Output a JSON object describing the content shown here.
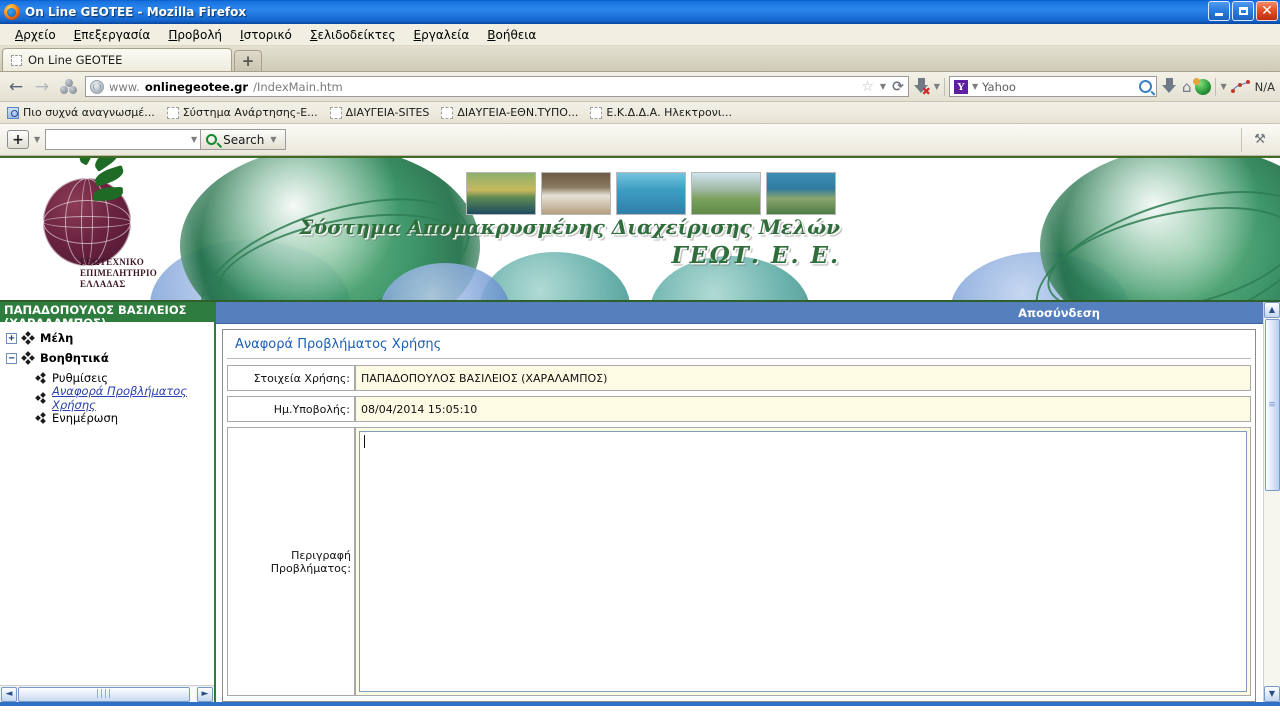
{
  "window": {
    "title": "On Line GEOTEE - Mozilla Firefox",
    "minimize_label": "Minimize",
    "maximize_label": "Maximize",
    "close_label": "✕"
  },
  "menu": {
    "items": [
      {
        "first": "Α",
        "rest": "ρχείο"
      },
      {
        "first": "Ε",
        "rest": "πεξεργασία"
      },
      {
        "first": "Π",
        "rest": "ροβολή"
      },
      {
        "first": "Ι",
        "rest": "στορικό"
      },
      {
        "first": "Σ",
        "rest": "ελιδοδείκτες"
      },
      {
        "first": "Ε",
        "rest": "ργαλεία"
      },
      {
        "first": "Β",
        "rest": "οήθεια"
      }
    ]
  },
  "tabs": {
    "active_tab_label": "On Line GEOTEE",
    "new_tab_label": "+"
  },
  "navbar": {
    "back_label": "←",
    "forward_label": "→",
    "url_prefix": "www.",
    "url_host": "onlinegeotee.gr",
    "url_path": "/IndexMain.htm",
    "star_label": "☆",
    "dropdown_label": "▼",
    "reload_label": "⟳",
    "search_engine": "Yahoo",
    "search_engine_badge": "Y",
    "search_placeholder": "Yahoo",
    "home_label": "⌂",
    "na_label": "N/A"
  },
  "bookmarks": {
    "items": [
      {
        "label": "Πιο συχνά αναγνωσμέ...",
        "icon": "folder-blue-icon"
      },
      {
        "label": "Σύστημα Ανάρτησης-Ε...",
        "icon": "blank-favicon"
      },
      {
        "label": "ΔΙΑΥΓΕΙΑ-SITES",
        "icon": "blank-favicon"
      },
      {
        "label": "ΔΙΑΥΓΕΙΑ-ΕΘΝ.ΤΥΠΟ...",
        "icon": "blank-favicon"
      },
      {
        "label": "Ε.Κ.Δ.Δ.Α. Ηλεκτρονι...",
        "icon": "blank-favicon"
      }
    ]
  },
  "plugin_toolbar": {
    "plus_label": "+",
    "dropdown_label": "▼",
    "input_value": "",
    "input_placeholder": "",
    "search_button_label": "Search",
    "search_dropdown_label": "▼",
    "wrench_label": "⚒"
  },
  "banner": {
    "title_line1": "Σύστημα Απομακρυσμένης Διαχείρισης Μελών",
    "title_line2": "ΓΕΩΤ. Ε. Ε.",
    "logo_line1": "ΓΕΩΤΕΧΝΙΚΟ",
    "logo_line2": "ΕΠΙΜΕΛΗΤΗΡΙΟ",
    "logo_line3": "ΕΛΛΑΔΑΣ",
    "photos": [
      "forest-river-photo",
      "sheep-photo",
      "boat-sea-photo",
      "field-photo",
      "dam-photo"
    ],
    "accent_green": "#2f6d3b"
  },
  "sidebar": {
    "user_header": "ΠΑΠΑΔΟΠΟΥΛΟΣ ΒΑΣΙΛΕΙΟΣ\n(ΧΑΡΑΛΑΜΠΟΣ)",
    "tree": [
      {
        "label": "Μέλη",
        "expander": "+",
        "level": 1,
        "link": false
      },
      {
        "label": "Βοηθητικά",
        "expander": "−",
        "level": 1,
        "link": false
      },
      {
        "label": "Ρυθμίσεις",
        "expander": "",
        "level": 2,
        "link": false
      },
      {
        "label": "Αναφορά Προβλήματος Χρήσης",
        "expander": "",
        "level": 2,
        "link": true
      },
      {
        "label": "Ενημέρωση",
        "expander": "",
        "level": 2,
        "link": false
      }
    ],
    "scroll_left_label": "◄",
    "scroll_right_label": "►",
    "scroll_grip": "||||"
  },
  "main": {
    "logout_label": "Αποσύνδεση",
    "panel_title": "Αναφορά Προβλήματος Χρήσης",
    "fields": [
      {
        "label": "Στοιχεία Χρήσης:",
        "value": "ΠΑΠΑΔΟΠΟΥΛΟΣ ΒΑΣΙΛΕΙΟΣ (ΧΑΡΑΛΑΜΠΟΣ)"
      },
      {
        "label": "Ημ.Υποβολής:",
        "value": "08/04/2014 15:05:10"
      }
    ],
    "description_label": "Περιγραφή\nΠροβλήματος:",
    "description_value": "",
    "scroll_up_label": "▲",
    "scroll_down_label": "▼",
    "scroll_grip": "≡"
  }
}
